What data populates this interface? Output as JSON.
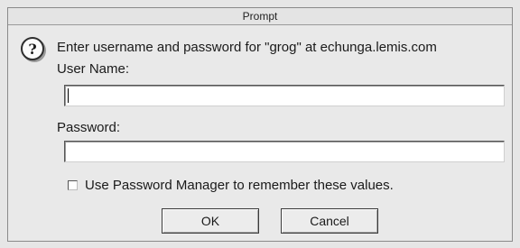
{
  "window": {
    "title": "Prompt"
  },
  "dialog": {
    "message": "Enter username and password for \"grog\" at echunga.lemis.com",
    "icon": "question-icon",
    "username_label": "User Name:",
    "username_value": "",
    "password_label": "Password:",
    "password_value": "",
    "remember_label": "Use Password Manager to remember these values.",
    "remember_checked": false
  },
  "buttons": {
    "ok_label": "OK",
    "cancel_label": "Cancel"
  }
}
